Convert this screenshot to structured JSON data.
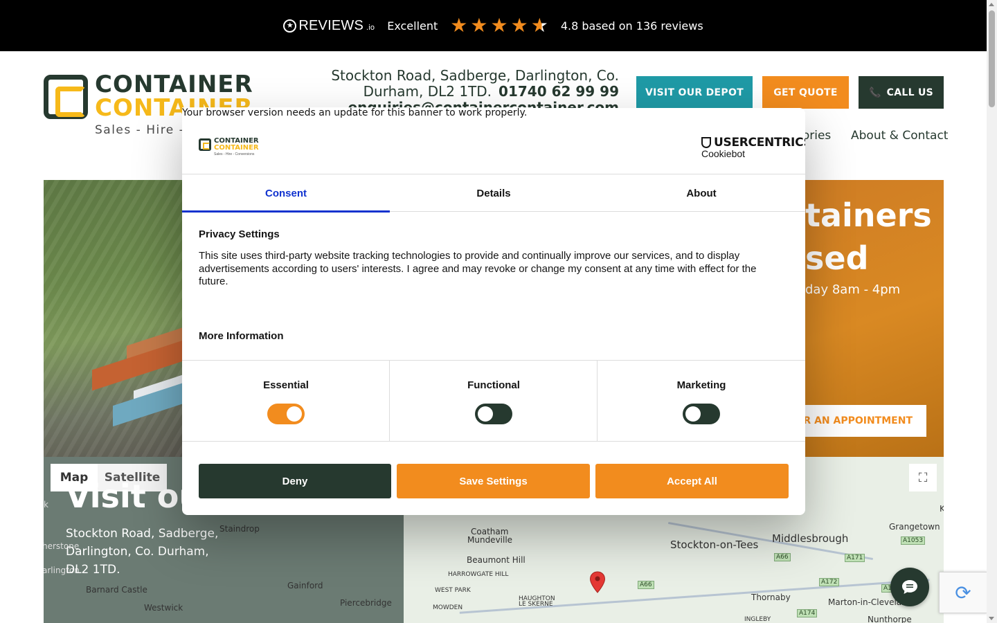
{
  "reviews_bar": {
    "brand": "REVIEWS",
    "brand_suffix": ".io",
    "rating_word": "Excellent",
    "stars": "4.5",
    "summary": "4.8 based on 136 reviews"
  },
  "header": {
    "logo_line1": "CONTAINER",
    "logo_line2": "CONTAINER",
    "logo_tagline": "Sales - Hire -",
    "address_line1": "Stockton Road, Sadberge, Darlington, Co.",
    "address_line2": "Durham, DL2 1TD.",
    "phone": "01740 62 99 99",
    "email": "enquiries@containercontainer.com",
    "buttons": {
      "depot": "VISIT OUR DEPOT",
      "quote": "GET QUOTE",
      "call": "CALL US"
    },
    "nav": {
      "accessories": "sories",
      "about": "About & Contact"
    }
  },
  "hero": {
    "title_line1": "tainers",
    "title_line2": "sed",
    "hours": "day 8am - 4pm",
    "appointment_button": "OR AN APPOINTMENT"
  },
  "map": {
    "tab_map": "Map",
    "tab_satellite": "Satellite",
    "visit_title": "Visit ou",
    "address_line1": "Stockton Road, Sadberge,",
    "address_line2": "Darlington, Co. Durham,",
    "address_line3": "DL2 1TD.",
    "places": {
      "staindrop": "Staindrop",
      "barnard": "Barnard Castle",
      "westwick": "Westwick",
      "gainford": "Gainford",
      "piercebridge": "Piercebridge",
      "coatham": "Coatham",
      "mundeville": "Mundeville",
      "beaumont": "Beaumont Hill",
      "harrowgate": "HARROWGATE HILL",
      "westpark": "WEST PARK",
      "haughton1": "HAUGHTON",
      "haughton2": "LE SKERNE",
      "mowden": "MOWDEN",
      "stockton": "Stockton-on-Tees",
      "middlesbrough": "Middlesbrough",
      "grangetown": "Grangetown",
      "thornaby": "Thornaby",
      "marton": "Marton-in-Cleveland",
      "nunthorpe": "Nunthorpe",
      "ingleby": "INGLEBY",
      "herstone": "herstone",
      "artington": "arlington",
      "k_left": "k",
      "k_right": "K"
    },
    "roads": {
      "a66": "A66",
      "a66b": "A66",
      "a171": "A171",
      "a1053": "A1053",
      "a172": "A172",
      "a174": "A174",
      "a174b": "A174"
    }
  },
  "cookie_modal": {
    "update_notice": "Your browser version needs an update for this banner to work properly.",
    "logo_line1": "CONTAINER",
    "logo_line2": "CONTAINER",
    "logo_tagline": "Sales - Hire - Conversions",
    "provider": "USERCENTRICS",
    "provider_sub": "Cookiebot",
    "tabs": [
      "Consent",
      "Details",
      "About"
    ],
    "privacy_heading": "Privacy Settings",
    "privacy_text": "This site uses third-party website tracking technologies to provide and continually improve our services, and to display advertisements according to users' interests. I agree and may revoke or change my consent at any time with effect for the future.",
    "more_info": "More Information",
    "categories": [
      {
        "label": "Essential",
        "enabled": true
      },
      {
        "label": "Functional",
        "enabled": false
      },
      {
        "label": "Marketing",
        "enabled": false
      }
    ],
    "buttons": {
      "deny": "Deny",
      "save": "Save Settings",
      "accept": "Accept All"
    }
  }
}
